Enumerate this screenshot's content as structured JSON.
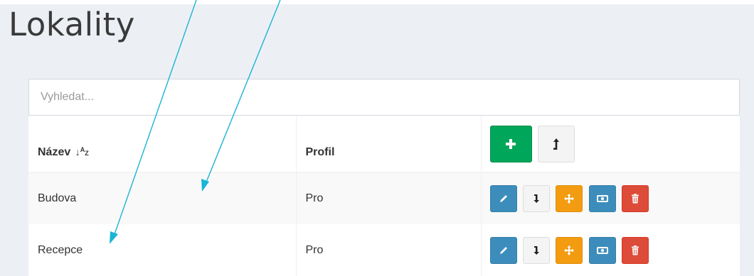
{
  "page": {
    "title": "Lokality"
  },
  "search": {
    "placeholder": "Vyhledat..."
  },
  "table": {
    "headers": {
      "name": "Název",
      "profile": "Profil"
    },
    "rows": [
      {
        "name": "Budova",
        "profile": "Pro"
      },
      {
        "name": "Recepce",
        "profile": "Pro"
      }
    ]
  },
  "icons": {
    "sort": "sort-alpha-down-icon",
    "add": "plus-icon",
    "move_up": "arrow-up-icon",
    "edit": "pencil-icon",
    "move_down": "arrow-down-icon",
    "move": "arrows-move-icon",
    "view": "money-bill-icon",
    "delete": "trash-icon"
  },
  "colors": {
    "success": "#00a65a",
    "primary": "#3c8dbc",
    "warning": "#f39c12",
    "danger": "#dd4b39",
    "default": "#f4f4f4",
    "annotation": "#1bb4d6",
    "background": "#ecf0f5"
  }
}
